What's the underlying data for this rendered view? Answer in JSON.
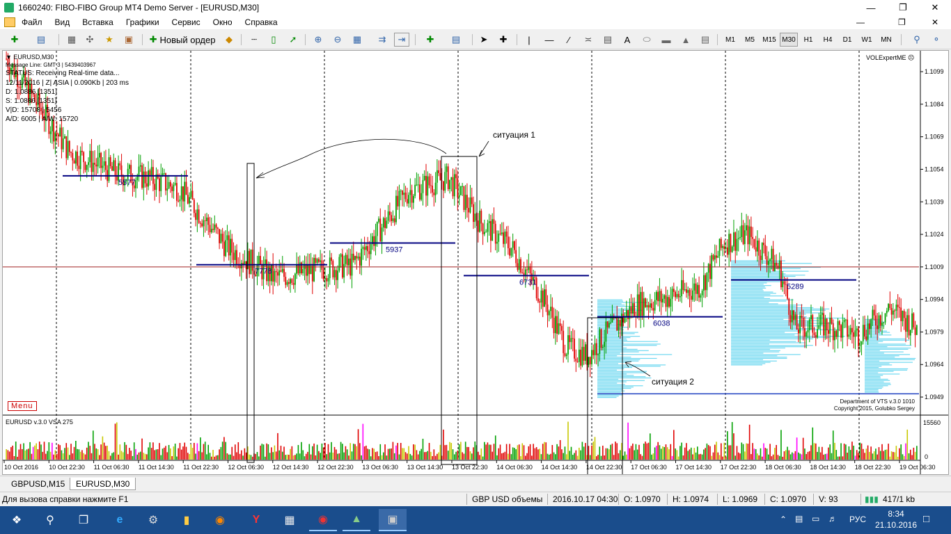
{
  "window": {
    "title": "1660240: FIBO-FIBO Group MT4 Demo Server - [EURUSD,M30]"
  },
  "menu": [
    "Файл",
    "Вид",
    "Вставка",
    "Графики",
    "Сервис",
    "Окно",
    "Справка"
  ],
  "toolbar": {
    "new_order_label": "Новый ордер",
    "timeframes": [
      "M1",
      "M5",
      "M15",
      "M30",
      "H1",
      "H4",
      "D1",
      "W1",
      "MN"
    ],
    "active_timeframe": "M30",
    "text_tool": "A"
  },
  "chart": {
    "symbol_header": "EURUSD,M30",
    "info_lines": [
      "Message Line: GMT 3 | 5439403967",
      "STATUS:  Receiving Real-time data...",
      "12/11/2016 | Z| ASIA | 0.090Kb | 203 ms",
      "D: 1.0886  [1351]",
      "S: 1.0886  [1351]",
      "V|D: 15708 | 5456",
      "A/D: 6005 | A/W: 15720"
    ],
    "expert_label": "VOLExpertME",
    "expert_icon": "smiley-icon",
    "menu_button": "Menu",
    "copyright_line1": "Department of VTS  v.3.0  1010",
    "copyright_line2": "Copyright 2015, Golubko Sergey",
    "price_labels": [
      "1.1099",
      "1.1084",
      "1.1069",
      "1.1054",
      "1.1039",
      "1.1024",
      "1.1009",
      "1.0994",
      "1.0979",
      "1.0964",
      "1.0949"
    ],
    "current_price": "1.1009",
    "time_labels": [
      "10 Oct 2016",
      "10 Oct 22:30",
      "11 Oct 06:30",
      "11 Oct 14:30",
      "11 Oct 22:30",
      "12 Oct 06:30",
      "12 Oct 14:30",
      "12 Oct 22:30",
      "13 Oct 06:30",
      "13 Oct 14:30",
      "13 Oct 22:30",
      "14 Oct 06:30",
      "14 Oct 14:30",
      "14 Oct 22:30",
      "17 Oct 06:30",
      "17 Oct 14:30",
      "17 Oct 22:30",
      "18 Oct 06:30",
      "18 Oct 14:30",
      "18 Oct 22:30",
      "19 Oct 06:30"
    ],
    "volume_levels": [
      {
        "label": "5577",
        "price": 1.1051
      },
      {
        "label": "7778",
        "price": 1.101
      },
      {
        "label": "5937",
        "price": 1.102
      },
      {
        "label": "6731",
        "price": 1.1005
      },
      {
        "label": "6038",
        "price": 1.0986
      },
      {
        "label": "5289",
        "price": 1.1003
      }
    ],
    "annotations": [
      "ситуация 1",
      "ситуация 2"
    ],
    "indicator_label": "EURUSD  v.3.0  VSA 275",
    "indicator_scale": [
      "15560",
      "0"
    ],
    "colors": {
      "bull": "#00a000",
      "bear": "#e00000",
      "level": "#000080",
      "current_line": "#a02020",
      "profile": "#6ed8f0",
      "vol_magenta": "#ff00ff"
    }
  },
  "chart_tabs": [
    "GBPUSD,M15",
    "EURUSD,M30"
  ],
  "active_tab": "EURUSD,M30",
  "statusbar": {
    "help": "Для вызова справки нажмите F1",
    "profile": "GBP USD объемы",
    "datetime": "2016.10.17 04:30",
    "open": "O: 1.0970",
    "high": "H: 1.0974",
    "low": "L: 1.0969",
    "close": "C: 1.0970",
    "volume": "V: 93",
    "traffic": "417/1 kb"
  },
  "taskbar": {
    "apps": [
      "windows-start-icon",
      "search-icon",
      "task-view-icon",
      "edge-icon",
      "control-panel-icon",
      "file-explorer-icon",
      "firefox-icon",
      "yandex-icon",
      "calculator-icon",
      "fibo-icon",
      "metatrader-icon",
      "media-icon"
    ],
    "language": "РУС",
    "time": "8:34",
    "date": "21.10.2016"
  }
}
